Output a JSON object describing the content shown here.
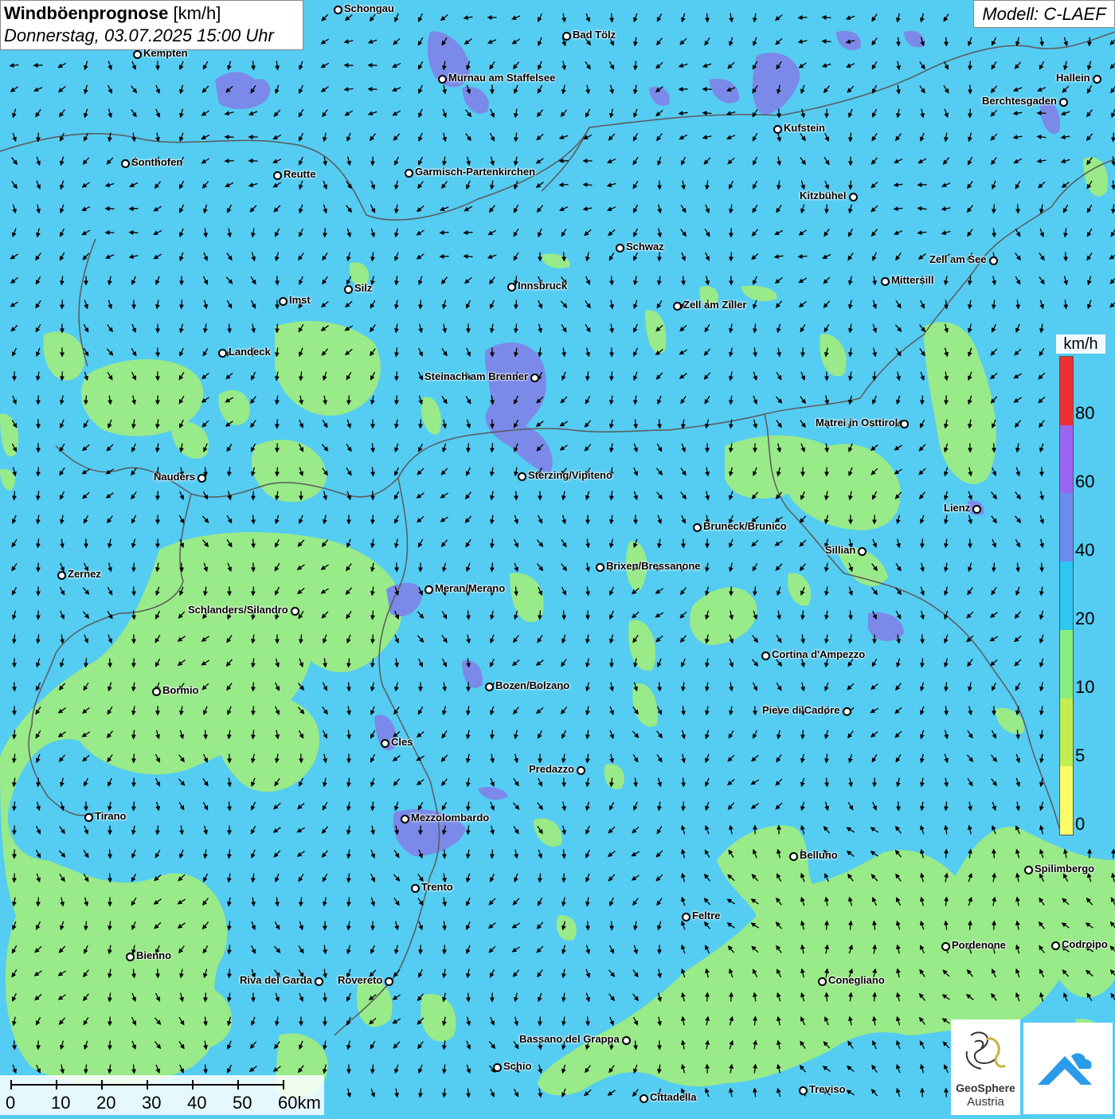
{
  "header": {
    "title_bold": "Windböenprognose",
    "title_unit": "[km/h]",
    "date": "Donnerstag, 03.07.2025 15:00 Uhr",
    "model": "Modell: C-LAEF"
  },
  "legend": {
    "unit": "km/h",
    "labels": [
      "80",
      "60",
      "40",
      "20",
      "10",
      "5",
      "0"
    ],
    "colors": [
      "#f03030",
      "#9a66ef",
      "#6a8cf0",
      "#2ec6f2",
      "#86ee7e",
      "#c4ee50",
      "#fbfb6a"
    ]
  },
  "scalebar": {
    "labels": [
      "0",
      "10",
      "20",
      "30",
      "40",
      "50",
      "60km"
    ]
  },
  "logo": {
    "name": "GeoSphere",
    "sub": "Austria"
  },
  "colors": {
    "base": "#55ccf2",
    "green": "#99ea88",
    "purple": "#7b8ae8",
    "border": "#666666"
  },
  "cities": [
    {
      "name": "Schongau"
    },
    {
      "name": "Kempten"
    },
    {
      "name": "Bad Tölz"
    },
    {
      "name": "Murnau am Staffelsee"
    },
    {
      "name": "Hallein"
    },
    {
      "name": "Berchtesgaden"
    },
    {
      "name": "Kufstein"
    },
    {
      "name": "Sonthofen"
    },
    {
      "name": "Reutte"
    },
    {
      "name": "Garmisch-Partenkirchen"
    },
    {
      "name": "Kitzbühel"
    },
    {
      "name": "Schwaz"
    },
    {
      "name": "Zell am See"
    },
    {
      "name": "Mittersill"
    },
    {
      "name": "Innsbruck"
    },
    {
      "name": "Silz"
    },
    {
      "name": "Imst"
    },
    {
      "name": "Zell am Ziller"
    },
    {
      "name": "Landeck"
    },
    {
      "name": "Steinach am Brenner"
    },
    {
      "name": "Matrei in Osttirol"
    },
    {
      "name": "Nauders"
    },
    {
      "name": "Sterzing/Vipiteno"
    },
    {
      "name": "Lienz"
    },
    {
      "name": "Bruneck/Brunico"
    },
    {
      "name": "Sillian"
    },
    {
      "name": "Zernez"
    },
    {
      "name": "Brixen/Bressanone"
    },
    {
      "name": "Meran/Merano"
    },
    {
      "name": "Schlanders/Silandro"
    },
    {
      "name": "Cortina d'Ampezzo"
    },
    {
      "name": "Bozen/Bolzano"
    },
    {
      "name": "Bormio"
    },
    {
      "name": "Pieve di Cadore"
    },
    {
      "name": "Cles"
    },
    {
      "name": "Predazzo"
    },
    {
      "name": "Tirano"
    },
    {
      "name": "Mezzolombardo"
    },
    {
      "name": "Belluno"
    },
    {
      "name": "Spilimbergo"
    },
    {
      "name": "Trento"
    },
    {
      "name": "Feltre"
    },
    {
      "name": "Pordenone"
    },
    {
      "name": "Codroipo"
    },
    {
      "name": "Bienno"
    },
    {
      "name": "Riva del Garda"
    },
    {
      "name": "Rovereto"
    },
    {
      "name": "Conegliano"
    },
    {
      "name": "Bassano del Grappa"
    },
    {
      "name": "Schio"
    },
    {
      "name": "Treviso"
    },
    {
      "name": "Cittadella"
    }
  ]
}
